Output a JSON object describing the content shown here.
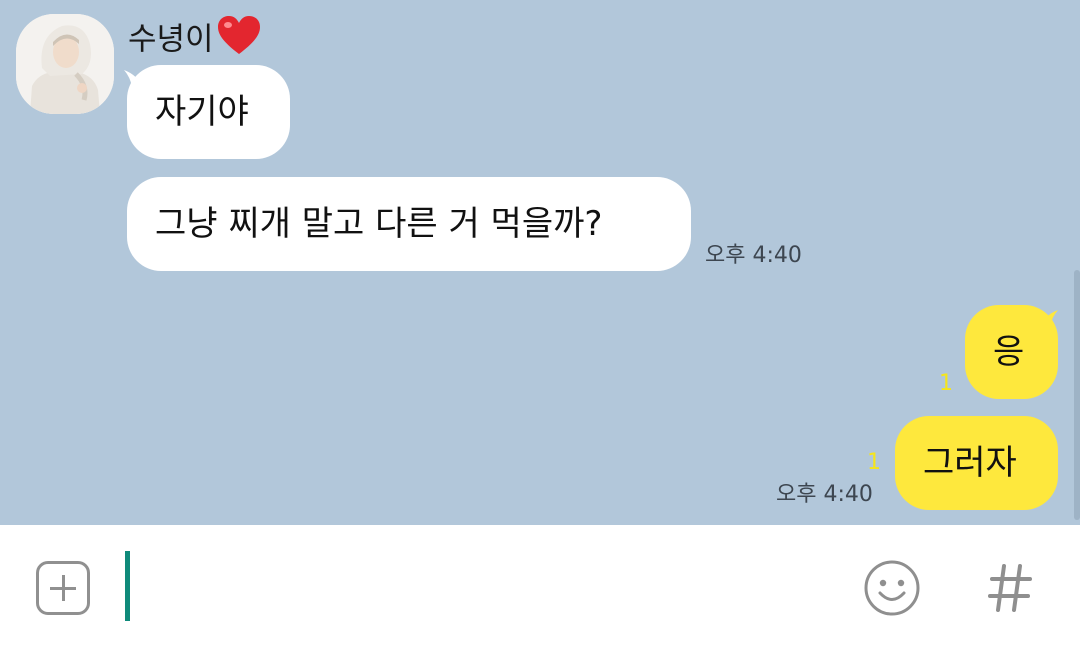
{
  "chat": {
    "sender_name": "수녕이",
    "received": [
      {
        "text": "자기야"
      },
      {
        "text": "그냥 찌개 말고 다른 거 먹을까?",
        "time": "오후 4:40"
      }
    ],
    "sent": [
      {
        "text": "응",
        "unread": "1"
      },
      {
        "text": "그러자",
        "unread": "1",
        "time": "오후 4:40"
      }
    ]
  },
  "input": {
    "placeholder": ""
  },
  "icons": {
    "attach": "plus-icon",
    "emoji": "smiley-icon",
    "hashtag": "hash-icon",
    "sender_emoji": "heart-icon"
  },
  "colors": {
    "chat_background": "#b2c7da",
    "sent_bubble": "#fee83d",
    "received_bubble": "#ffffff",
    "unread_count": "#f5e51c",
    "cursor": "#0f8a7a"
  }
}
